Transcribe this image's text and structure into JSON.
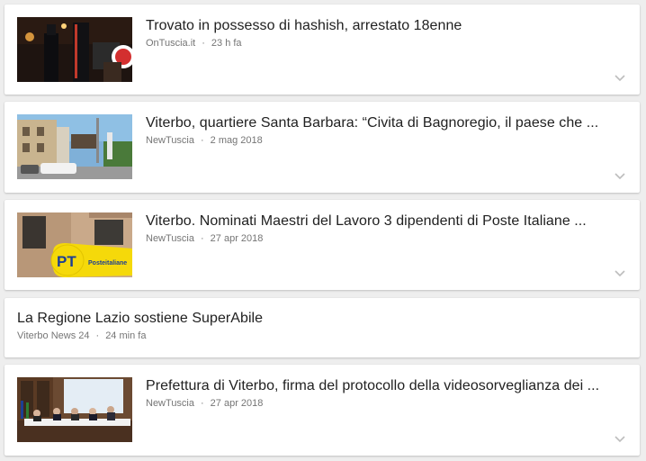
{
  "articles": [
    {
      "title": "Trovato in possesso di hashish, arrestato 18enne",
      "source": "OnTuscia.it",
      "separator": "·",
      "time": "23 h fa",
      "has_thumbnail": true,
      "thumbnail": "police-night-photo"
    },
    {
      "title": "Viterbo, quartiere Santa Barbara: “Civita di Bagnoregio, il paese che ...",
      "source": "NewTuscia",
      "separator": "·",
      "time": "2 mag 2018",
      "has_thumbnail": true,
      "thumbnail": "street-buildings-photo"
    },
    {
      "title": "Viterbo. Nominati Maestri del Lavoro 3 dipendenti di Poste Italiane ...",
      "source": "NewTuscia",
      "separator": "·",
      "time": "27 apr 2018",
      "has_thumbnail": true,
      "thumbnail": "poste-italiane-sign-photo",
      "thumbnail_text": {
        "logo": "PT",
        "brand": "Posteitaliane"
      }
    },
    {
      "title": "La Regione Lazio sostiene SuperAbile",
      "source": "Viterbo News 24",
      "separator": "·",
      "time": "24 min fa",
      "has_thumbnail": false
    },
    {
      "title": "Prefettura di Viterbo, firma del protocollo della videosorveglianza dei ...",
      "source": "NewTuscia",
      "separator": "·",
      "time": "27 apr 2018",
      "has_thumbnail": true,
      "thumbnail": "conference-room-photo"
    }
  ],
  "icons": {
    "expand": "chevron-down-icon"
  },
  "colors": {
    "background": "#eeeeee",
    "card": "#ffffff",
    "title": "#212121",
    "meta": "#757575",
    "chevron": "#bdbdbd",
    "poste_yellow": "#f5d90a",
    "poste_blue": "#1c3f94"
  }
}
